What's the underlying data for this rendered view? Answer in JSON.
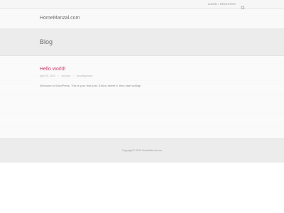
{
  "topbar": {
    "login_label": "LOGIN / REGISTER",
    "search_icon": "search-icon"
  },
  "header": {
    "brand": "HomeManzal.com"
  },
  "page": {
    "title": "Blog"
  },
  "post": {
    "title": "Hello world!",
    "date": "April 20, 2019",
    "author": "No phot",
    "category": "Uncategorized",
    "excerpt": "Welcome to WordPress. This is your first post. Edit or delete it, then start writing!"
  },
  "footer": {
    "copyright": "Copyright © 2019 HomeManzal.com"
  },
  "colors": {
    "accent": "#c9386e",
    "background": "#fbfbfb",
    "band": "#ececec"
  }
}
